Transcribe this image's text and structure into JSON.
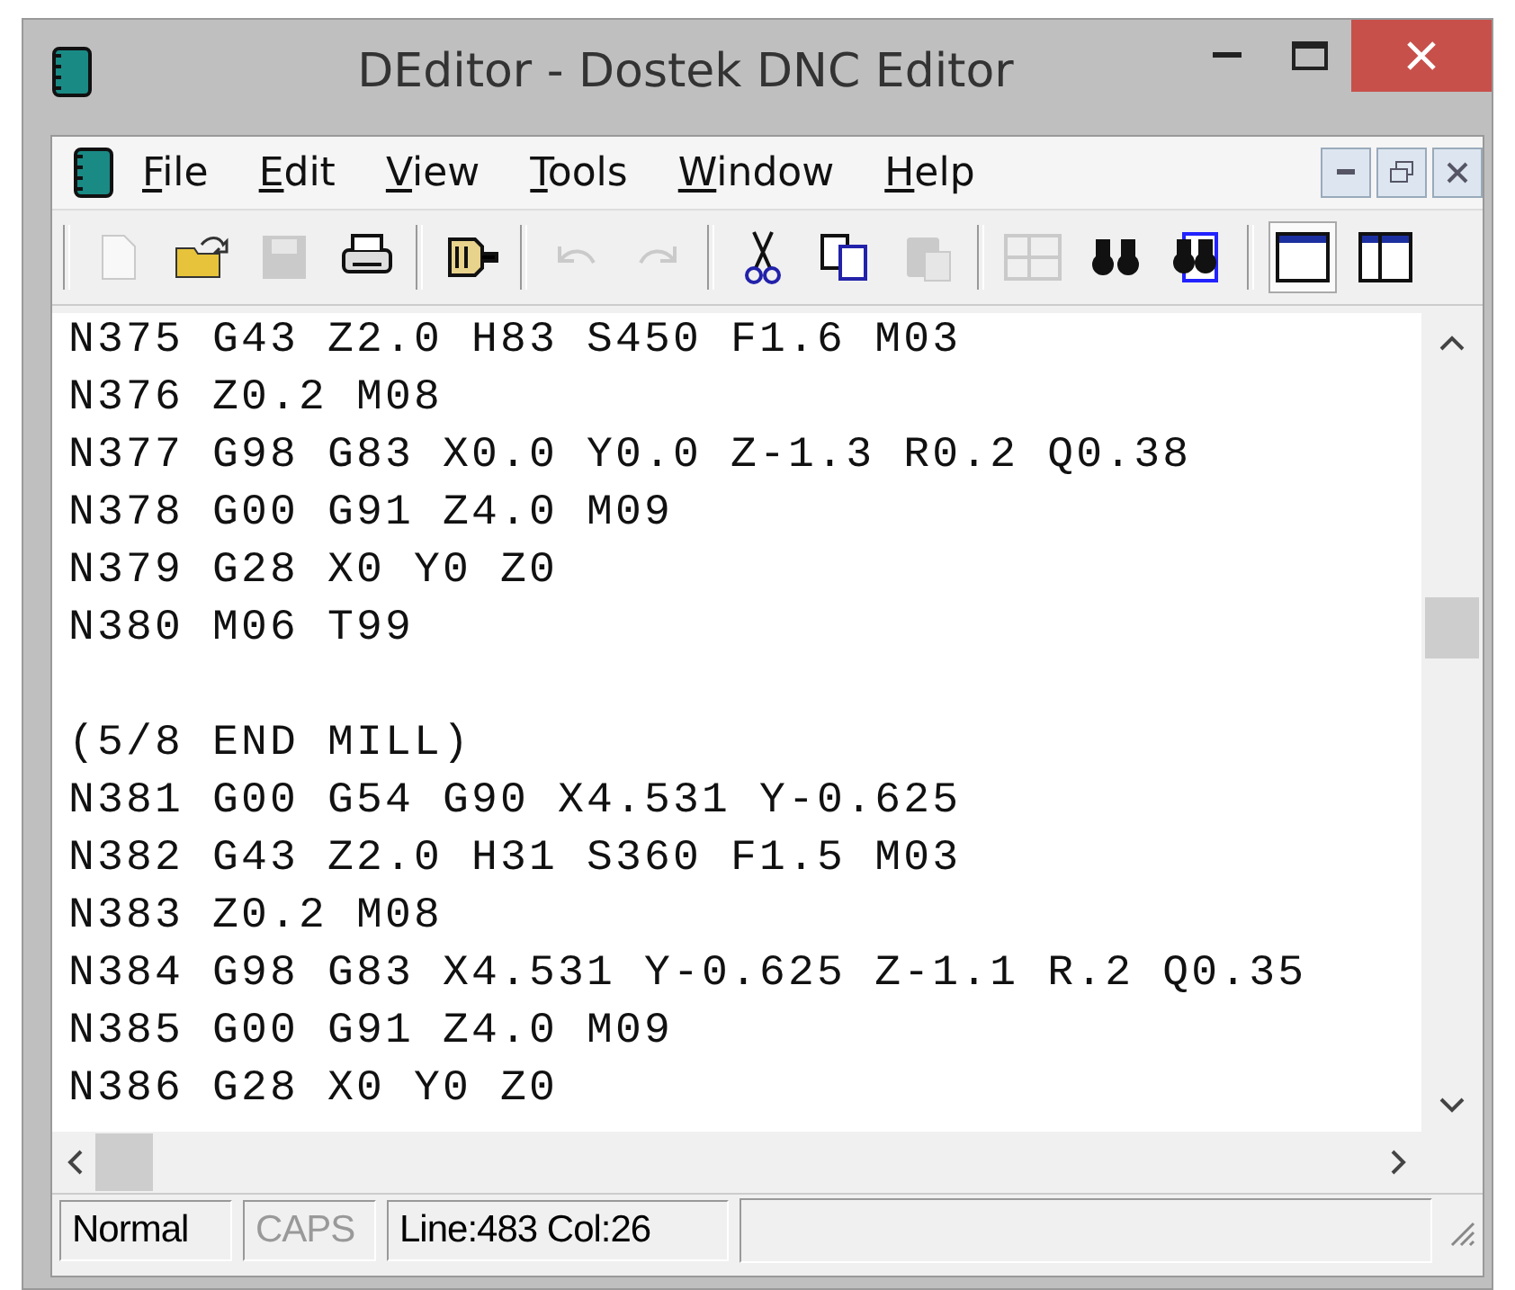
{
  "window": {
    "title": "DEditor - Dostek DNC Editor"
  },
  "menu": [
    "File",
    "Edit",
    "View",
    "Tools",
    "Window",
    "Help"
  ],
  "toolbar": [
    {
      "kind": "new",
      "disabled": true
    },
    {
      "kind": "open",
      "disabled": false
    },
    {
      "kind": "save",
      "disabled": true
    },
    {
      "kind": "print",
      "disabled": false
    },
    {
      "kind": "sep"
    },
    {
      "kind": "connector",
      "disabled": false
    },
    {
      "kind": "sep"
    },
    {
      "kind": "undo",
      "disabled": true
    },
    {
      "kind": "redo",
      "disabled": true
    },
    {
      "kind": "sep"
    },
    {
      "kind": "cut",
      "disabled": false
    },
    {
      "kind": "copy",
      "disabled": false
    },
    {
      "kind": "paste",
      "disabled": true
    },
    {
      "kind": "sep"
    },
    {
      "kind": "split",
      "disabled": true
    },
    {
      "kind": "find",
      "disabled": false
    },
    {
      "kind": "findfile",
      "disabled": false
    },
    {
      "kind": "sep"
    },
    {
      "kind": "window",
      "disabled": false,
      "selected": true
    },
    {
      "kind": "columns",
      "disabled": false,
      "selected": false
    }
  ],
  "editor": {
    "lines": [
      "N375 G43 Z2.0 H83 S450 F1.6 M03",
      "N376 Z0.2 M08",
      "N377 G98 G83 X0.0 Y0.0 Z-1.3 R0.2 Q0.38",
      "N378 G00 G91 Z4.0 M09",
      "N379 G28 X0 Y0 Z0",
      "N380 M06 T99"
    ],
    "lines_after_blank": [
      "(5/8 END MILL)",
      "N381 G00 G54 G90 X4.531 Y-0.625",
      "N382 G43 Z2.0 H31 S360 F1.5 M03",
      "N383 Z0.2 M08",
      "N384 G98 G83 X4.531 Y-0.625 Z-1.1 R.2 Q0.35",
      "N385 G00 G91 Z4.0 M09",
      "N386 G28 X0 Y0 Z0"
    ]
  },
  "status_bar": [
    {
      "text": "Normal",
      "enabled": true
    },
    {
      "text": "CAPS",
      "enabled": false
    },
    {
      "text": "Line:483 Col:26",
      "enabled": true
    }
  ]
}
